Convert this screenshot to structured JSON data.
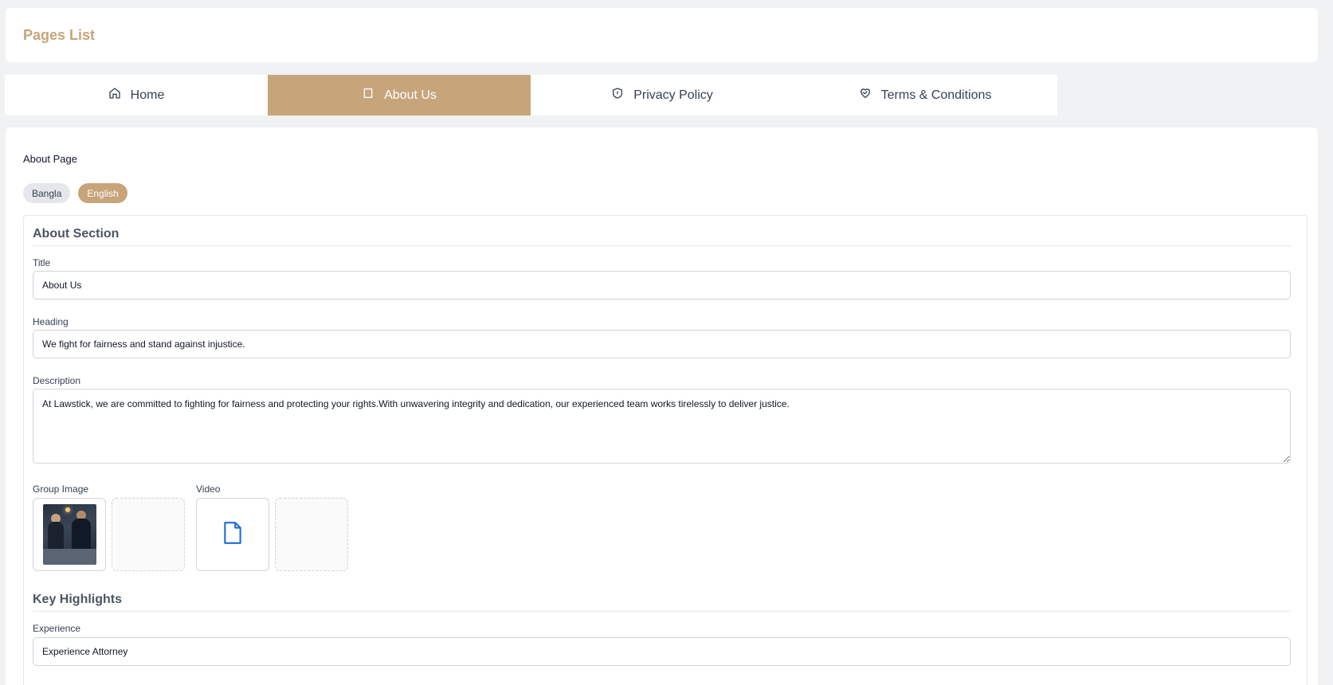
{
  "header": {
    "title": "Pages List"
  },
  "tabs": [
    {
      "label": "Home",
      "icon": "home-icon"
    },
    {
      "label": "About Us",
      "icon": "square-icon",
      "active": true
    },
    {
      "label": "Privacy Policy",
      "icon": "shield-icon"
    },
    {
      "label": "Terms & Conditions",
      "icon": "heart-handshake-icon"
    }
  ],
  "colors": {
    "accent": "#c8a47a",
    "background": "#f1f2f4"
  },
  "content": {
    "page_label": "About Page",
    "languages": [
      {
        "label": "Bangla",
        "active": false
      },
      {
        "label": "English",
        "active": true
      }
    ],
    "about_section": {
      "title": "About Section",
      "title_field": {
        "label": "Title",
        "value": "About Us"
      },
      "heading_field": {
        "label": "Heading",
        "value": "We fight for fairness and stand against injustice."
      },
      "description_field": {
        "label": "Description",
        "value": "At Lawstick, we are committed to fighting for fairness and protecting your rights.With unwavering integrity and dedication, our experienced team works tirelessly to deliver justice."
      },
      "group_image": {
        "label": "Group Image"
      },
      "video": {
        "label": "Video",
        "icon": "file-icon"
      }
    },
    "key_highlights": {
      "title": "Key Highlights",
      "experience_field": {
        "label": "Experience",
        "value": "Experience Attorney"
      }
    }
  }
}
